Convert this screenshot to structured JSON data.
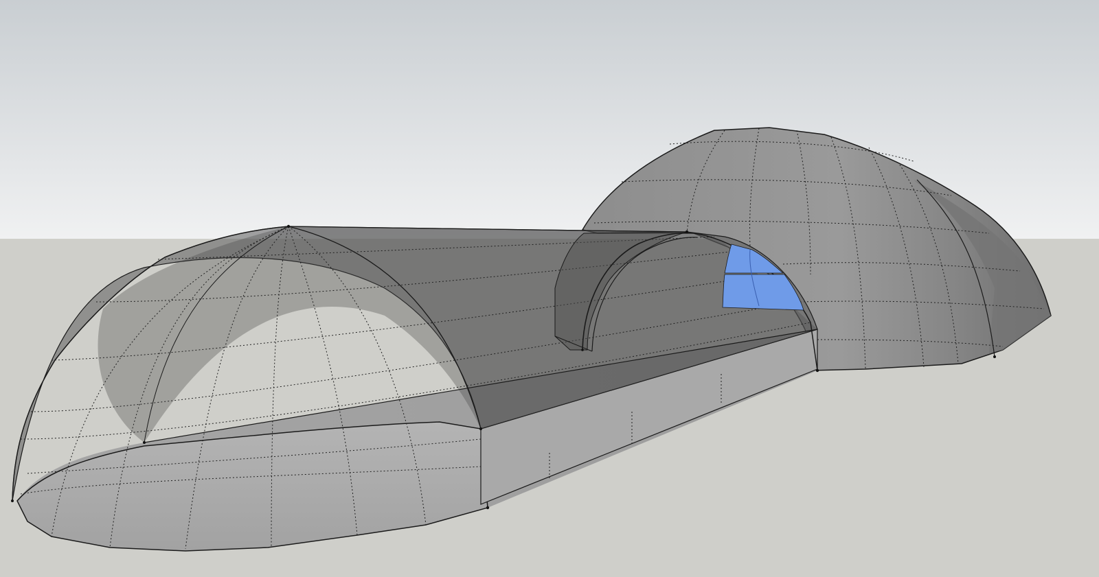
{
  "app": {
    "view": "3d-model-viewport"
  },
  "scene": {
    "sky_top_color": "#c9ced2",
    "sky_bottom_color": "#eff1f2",
    "ground_color": "#cfcfca",
    "solid_face_color": "#a6a6a6",
    "shadow_face_color": "#6f6f6f",
    "translucent_face_color": "#5c5c5c",
    "selected_face_color": "#6f9be8",
    "edge_color": "#1a1a1a",
    "hidden_edge_style": "dotted"
  },
  "objects": [
    {
      "name": "large-dome",
      "kind": "hemisphere"
    },
    {
      "name": "elongated-dome",
      "kind": "half-capsule"
    },
    {
      "name": "connecting-arch",
      "kind": "arch-opening"
    }
  ],
  "selection": {
    "count": 2,
    "face_color": "#6f9be8"
  }
}
